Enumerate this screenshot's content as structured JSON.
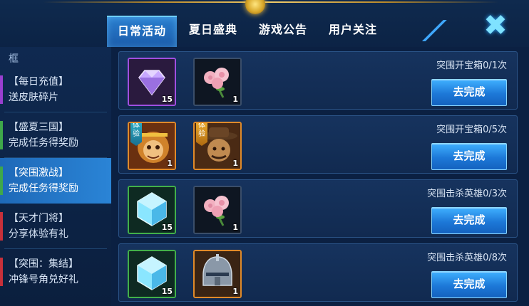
{
  "tabs": [
    {
      "label": "日常活动",
      "active": true
    },
    {
      "label": "夏日盛典",
      "active": false
    },
    {
      "label": "游戏公告",
      "active": false
    },
    {
      "label": "用户关注",
      "active": false
    }
  ],
  "sidebar": {
    "heading": "框",
    "items": [
      {
        "line1": "【每日充值】",
        "line2": "送皮肤碎片",
        "marker": "#9a3fd0",
        "active": false
      },
      {
        "line1": "【盛夏三国】",
        "line2": "完成任务得奖励",
        "marker": "#3fa84a",
        "active": false
      },
      {
        "line1": "【突围激战】",
        "line2": "完成任务得奖励",
        "marker": "#3fa84a",
        "active": true
      },
      {
        "line1": "【天才门将】",
        "line2": "分享体验有礼",
        "marker": "#c8303a",
        "active": false
      },
      {
        "line1": "【突围：集结】",
        "line2": "冲锋号角兑好礼",
        "marker": "#c8303a",
        "active": false
      }
    ]
  },
  "tasks": [
    {
      "text": "突围开宝箱0/1次",
      "button": "去完成",
      "rewards": [
        {
          "icon": "diamond-icon",
          "qty": "15"
        },
        {
          "icon": "rose-bouquet-icon",
          "qty": "1"
        }
      ]
    },
    {
      "text": "突围开宝箱0/5次",
      "button": "去完成",
      "rewards": [
        {
          "icon": "monkey-king-hero-icon",
          "qty": "1",
          "tag": "体验"
        },
        {
          "icon": "cowboy-hero-icon",
          "qty": "1",
          "tag": "体验"
        }
      ]
    },
    {
      "text": "突围击杀英雄0/3次",
      "button": "去完成",
      "rewards": [
        {
          "icon": "blue-crystal-icon",
          "qty": "15"
        },
        {
          "icon": "rose-bouquet-icon",
          "qty": "1"
        }
      ]
    },
    {
      "text": "突围击杀英雄0/8次",
      "button": "去完成",
      "rewards": [
        {
          "icon": "blue-crystal-icon",
          "qty": "15"
        },
        {
          "icon": "knight-helmet-icon",
          "qty": "1"
        }
      ]
    }
  ],
  "colors": {
    "accent": "#2a84d6",
    "button": "#1d78d8"
  }
}
